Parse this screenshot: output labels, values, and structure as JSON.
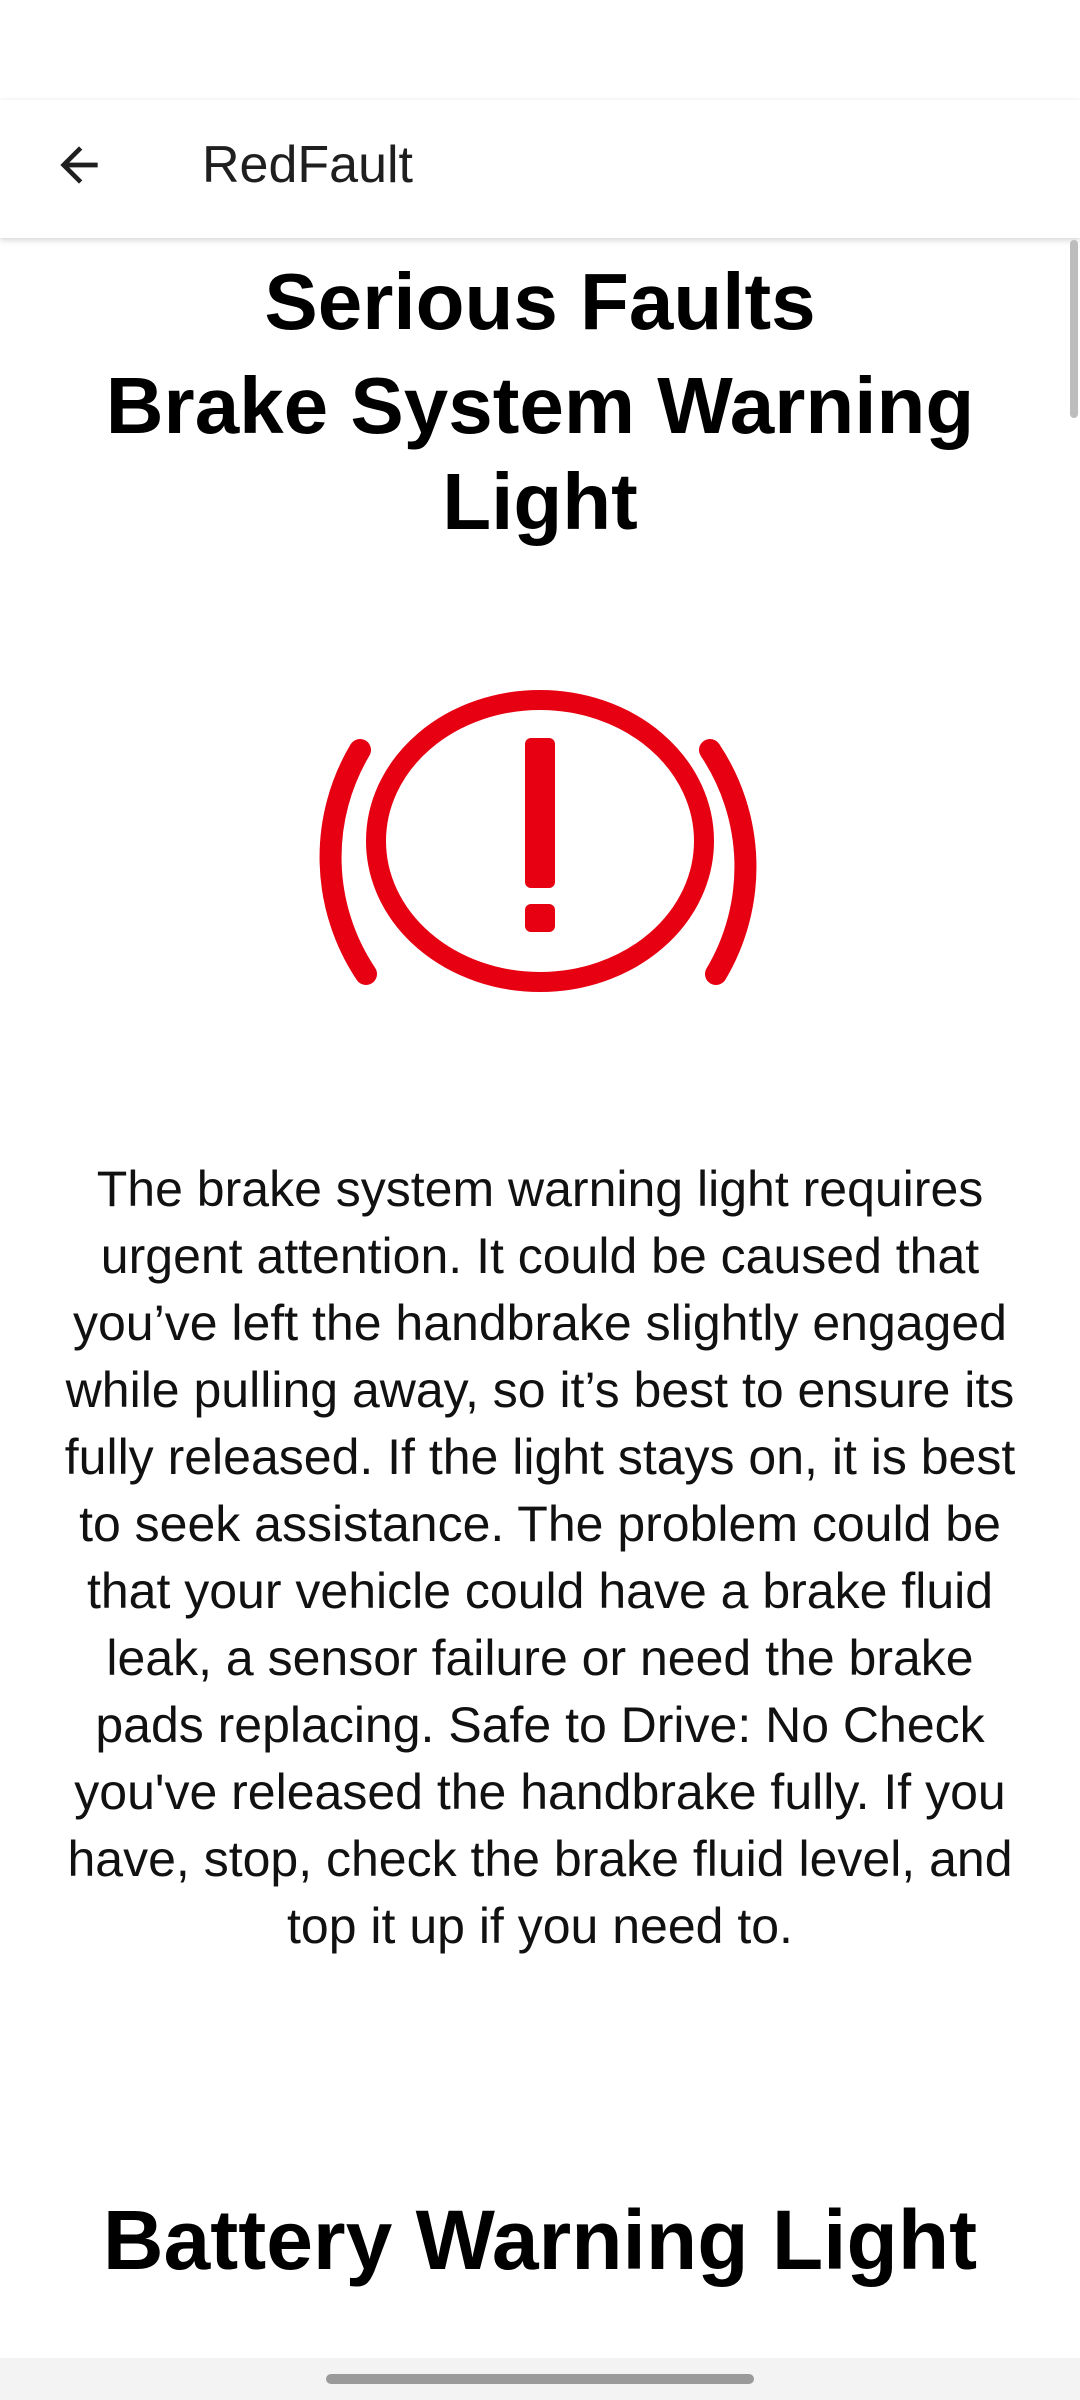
{
  "app_bar": {
    "title": "RedFault",
    "back_icon": "arrow-left-icon"
  },
  "content": {
    "category_heading": "Serious Faults",
    "sections": [
      {
        "title": "Brake System Warning Light",
        "image_icon": "brake-warning-icon",
        "image_color": "#e60012",
        "description": "The brake system warning light requires urgent attention. It could be caused that you’ve left the handbrake slightly engaged while pulling away, so it’s best to ensure its fully released. If the light stays on, it is best to seek assistance. The problem could be that your vehicle could have a brake fluid leak, a sensor failure or need the brake pads replacing. Safe to Drive: No Check you've released the handbrake fully. If you have, stop, check the brake fluid level, and top it up if you need to."
      },
      {
        "title": "Battery Warning Light"
      }
    ]
  },
  "colors": {
    "warning_red": "#e60012",
    "text": "#000000",
    "app_bar_bg": "#ffffff"
  }
}
